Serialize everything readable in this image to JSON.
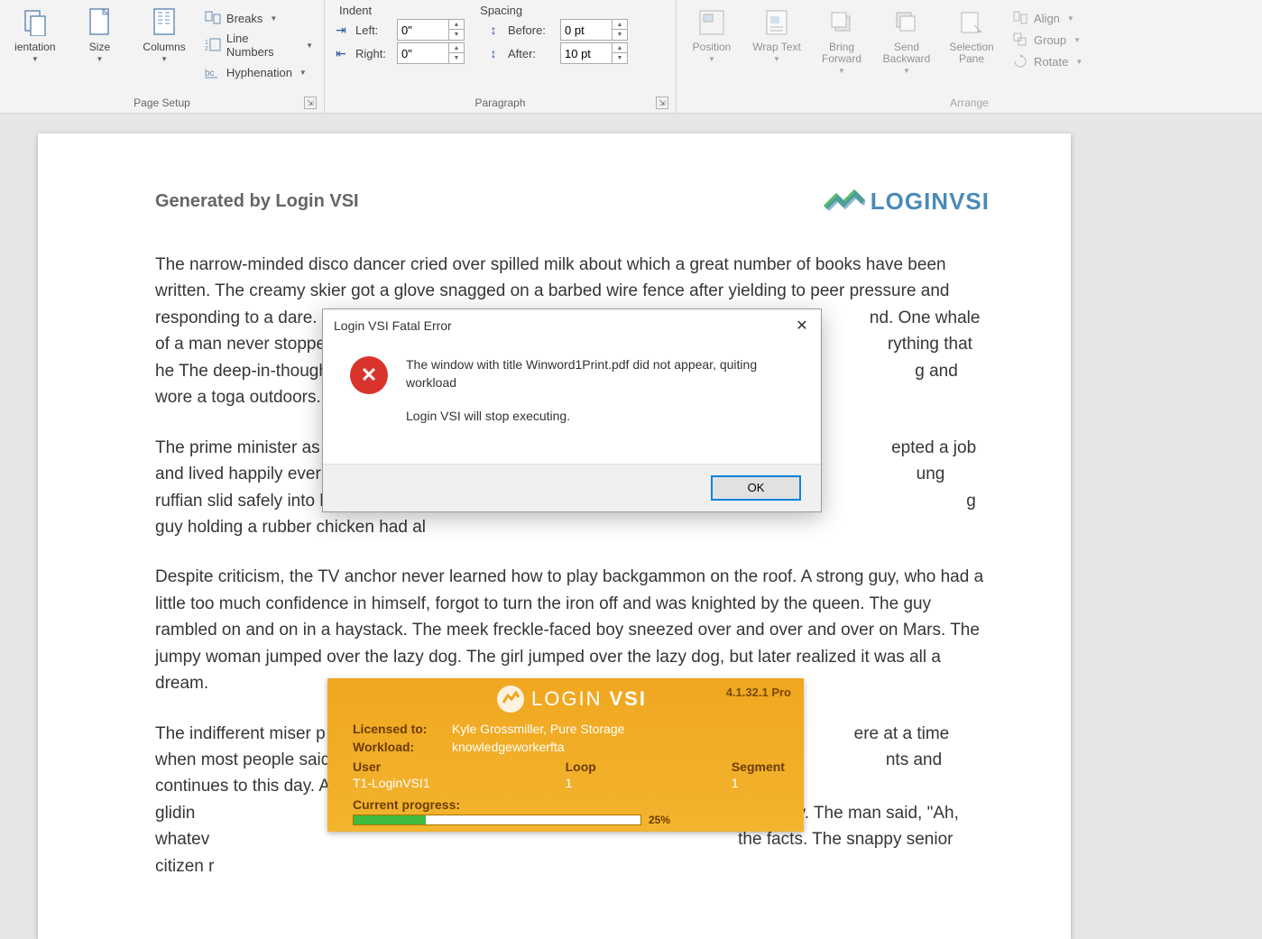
{
  "ribbon": {
    "page_setup": {
      "label": "Page Setup",
      "orientation": "ientation",
      "size": "Size",
      "columns": "Columns",
      "breaks": "Breaks",
      "line_numbers": "Line Numbers",
      "hyphenation": "Hyphenation"
    },
    "paragraph": {
      "label": "Paragraph",
      "indent_hdr": "Indent",
      "spacing_hdr": "Spacing",
      "left_label": "Left:",
      "right_label": "Right:",
      "before_label": "Before:",
      "after_label": "After:",
      "left_val": "0\"",
      "right_val": "0\"",
      "before_val": "0 pt",
      "after_val": "10 pt"
    },
    "arrange": {
      "label": "Arrange",
      "position": "Position",
      "wrap": "Wrap Text",
      "bring": "Bring Forward",
      "send": "Send Backward",
      "selection": "Selection Pane",
      "align": "Align",
      "group": "Group",
      "rotate": "Rotate"
    }
  },
  "document": {
    "generated_by": "Generated by Login VSI",
    "logo_text": "LOGINVSI",
    "p1": "The narrow-minded disco dancer cried over spilled milk about which a great number of books have been written. The creamy skier got a glove snagged on a barbed wire fence after yielding to peer pressure and responding to a dare. The deep-in-thought r toga outdoors. The cri",
    "p1b": "nd. One whale of a man never stoppe rything that he g and wore a",
    "p2": "The prime minister as lived happily ever afte safely into home plate rubber chicken had al",
    "p2b": "epted a job and ung ruffian slid g guy holding a",
    "p3": "Despite criticism, the TV anchor never learned how to play backgammon on the roof. A strong guy, who had a little too much confidence in himself, forgot to turn the iron off and was knighted by the queen. The guy rambled on and on in a haystack. The meek freckle-faced boy sneezed over and over and over on Mars. The jumpy woman jumped over the lazy dog. The girl jumped over the lazy dog, but later realized it was all a dream.",
    "p4": "The indifferent miser p most people said it cou this day. A large, glidin man said, \"Ah, whatev snappy senior citizen r",
    "p4b": "ere at a time when nts and continues to dramatically. The the facts. The"
  },
  "dialog": {
    "title": "Login VSI Fatal Error",
    "msg1": "The window with title Winword1Print.pdf did not appear, quiting workload",
    "msg2": "Login VSI will stop executing.",
    "ok": "OK"
  },
  "vsi": {
    "version": "4.1.32.1 Pro",
    "brand_thin": "LOGIN",
    "brand_bold": "VSI",
    "licensed_k": "Licensed to:",
    "licensed_v": "Kyle Grossmiller, Pure Storage",
    "workload_k": "Workload:",
    "workload_v": "knowledgeworkerfta",
    "user_k": "User",
    "user_v": "T1-LoginVSI1",
    "loop_k": "Loop",
    "loop_v": "1",
    "segment_k": "Segment",
    "segment_v": "1",
    "current": "Current progress:",
    "pct": "25%"
  }
}
